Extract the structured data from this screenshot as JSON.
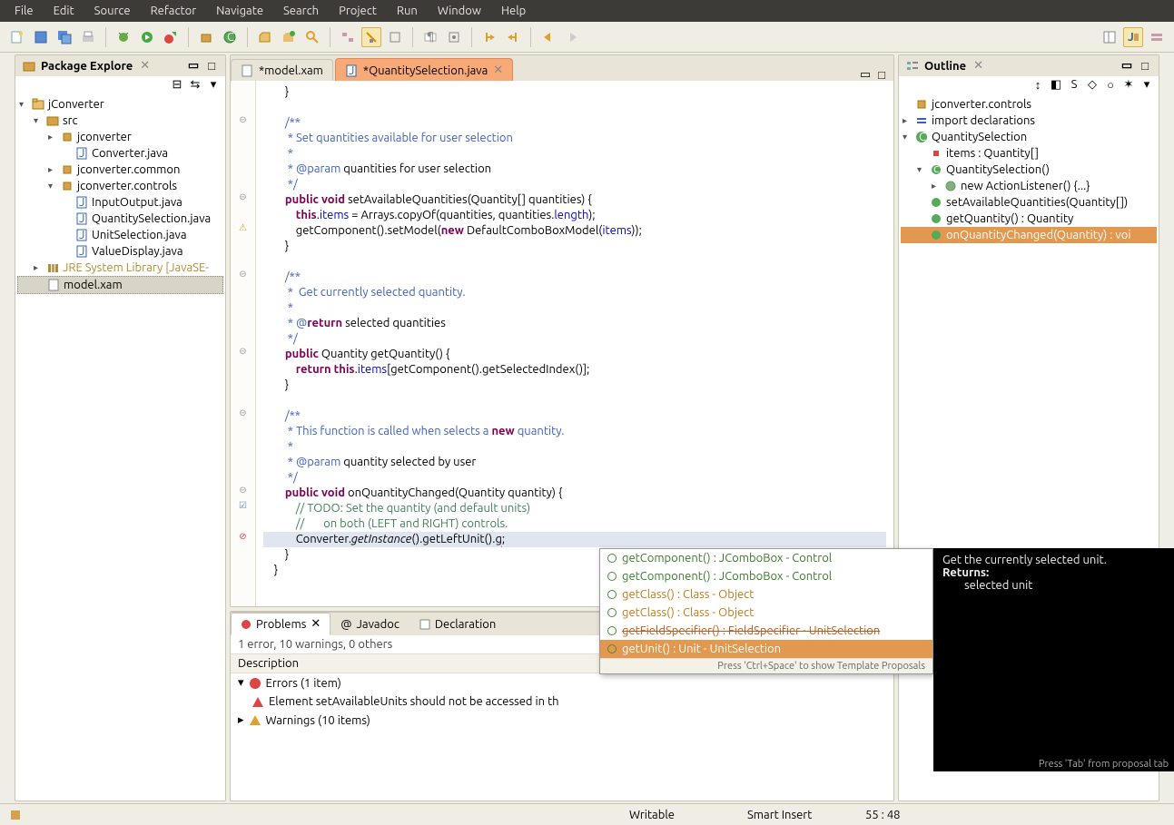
{
  "menu": {
    "items": [
      "File",
      "Edit",
      "Source",
      "Refactor",
      "Navigate",
      "Search",
      "Project",
      "Run",
      "Window",
      "Help"
    ]
  },
  "pkg_explorer": {
    "title": "Package Explore",
    "tree": [
      {
        "l": 0,
        "t": "▾",
        "i": "proj",
        "label": "jConverter"
      },
      {
        "l": 1,
        "t": "▾",
        "i": "folder",
        "label": "src"
      },
      {
        "l": 2,
        "t": "▸",
        "i": "pkg",
        "label": "jconverter"
      },
      {
        "l": 3,
        "t": "",
        "i": "jfile",
        "label": "Converter.java"
      },
      {
        "l": 2,
        "t": "▸",
        "i": "pkg",
        "label": "jconverter.common"
      },
      {
        "l": 2,
        "t": "▾",
        "i": "pkg",
        "label": "jconverter.controls"
      },
      {
        "l": 3,
        "t": "",
        "i": "jfile",
        "label": "InputOutput.java"
      },
      {
        "l": 3,
        "t": "",
        "i": "jfile",
        "label": "QuantitySelection.java"
      },
      {
        "l": 3,
        "t": "",
        "i": "jfile",
        "label": "UnitSelection.java"
      },
      {
        "l": 3,
        "t": "",
        "i": "jfile",
        "label": "ValueDisplay.java"
      },
      {
        "l": 1,
        "t": "▸",
        "i": "lib",
        "label": "JRE System Library [JavaSE-"
      },
      {
        "l": 1,
        "t": "",
        "i": "sel",
        "label": "model.xam",
        "sel": true
      }
    ]
  },
  "editor": {
    "tabs": [
      {
        "label": "*model.xam",
        "active": false
      },
      {
        "label": "*QuantitySelection.java",
        "active": true
      }
    ]
  },
  "code_lines": [
    "        }",
    "",
    "        /**",
    "         * Set quantities available for user selection",
    "         *",
    "         * @param quantities for user selection",
    "         */",
    "        public void setAvailableQuantities(Quantity[] quantities) {",
    "            this.items = Arrays.copyOf(quantities, quantities.length);",
    "            getComponent().setModel(new DefaultComboBoxModel(items));",
    "        }",
    "",
    "        /**",
    "         *  Get currently selected quantity.",
    "         *",
    "         * @return selected quantities",
    "         */",
    "        public Quantity getQuantity() {",
    "            return this.items[getComponent().getSelectedIndex()];",
    "        }",
    "",
    "        /**",
    "         * This function is called when selects a new quantity.",
    "         *",
    "         * @param quantity selected by user",
    "         */",
    "        public void onQuantityChanged(Quantity quantity) {",
    "            // TODO: Set the quantity (and default units)",
    "            //       on both (LEFT and RIGHT) controls.",
    "            Converter.getInstance().getLeftUnit().g;",
    "        }",
    "    }"
  ],
  "problems": {
    "tabs": [
      "Problems",
      "Javadoc",
      "Declaration"
    ],
    "summary": "1 error, 10 warnings, 0 others",
    "col_header": "Description",
    "rows": [
      {
        "t": "err_group",
        "label": "Errors (1 item)"
      },
      {
        "t": "err_item",
        "label": "Element setAvailableUnits should not be accessed in th"
      },
      {
        "t": "warn_group",
        "label": "Warnings (10 items)"
      }
    ]
  },
  "outline": {
    "title": "Outline",
    "items": [
      {
        "l": 0,
        "i": "pkg",
        "label": "jconverter.controls"
      },
      {
        "l": 0,
        "i": "imp",
        "label": "import declarations",
        "t": "▸"
      },
      {
        "l": 0,
        "i": "class",
        "label": "QuantitySelection",
        "t": "▾"
      },
      {
        "l": 1,
        "i": "field",
        "label": "items : Quantity[]"
      },
      {
        "l": 1,
        "i": "ctor",
        "label": "QuantitySelection()",
        "t": "▾"
      },
      {
        "l": 2,
        "i": "anon",
        "label": "new ActionListener() {...}",
        "t": "▸"
      },
      {
        "l": 1,
        "i": "method",
        "label": "setAvailableQuantities(Quantity[])"
      },
      {
        "l": 1,
        "i": "method",
        "label": "getQuantity() : Quantity"
      },
      {
        "l": 1,
        "i": "method",
        "label": "onQuantityChanged(Quantity) : voi",
        "sel": true
      }
    ]
  },
  "assist": {
    "rows": [
      {
        "cls": "txt-green",
        "label": "getComponent() : JComboBox - Control"
      },
      {
        "cls": "txt-green",
        "label": "getComponent() : JComboBox - Control"
      },
      {
        "cls": "txt-orange",
        "label": "getClass() : Class<?> - Object"
      },
      {
        "cls": "txt-orange",
        "label": "getClass() : Class<?> - Object"
      },
      {
        "cls": "txt-strike",
        "label": "getFieldSpecifier() : FieldSpecifier - UnitSelection"
      },
      {
        "cls": "txt-orange",
        "label": "getUnit() : Unit - UnitSelection",
        "sel": true
      }
    ],
    "hint": "Press 'Ctrl+Space' to show Template Proposals"
  },
  "doc": {
    "line1": "Get the currently selected unit.",
    "returns_label": "Returns:",
    "returns_val": "selected unit",
    "hint": "Press 'Tab' from proposal tab"
  },
  "status": {
    "writable": "Writable",
    "insert": "Smart Insert",
    "pos": "55 : 48"
  }
}
